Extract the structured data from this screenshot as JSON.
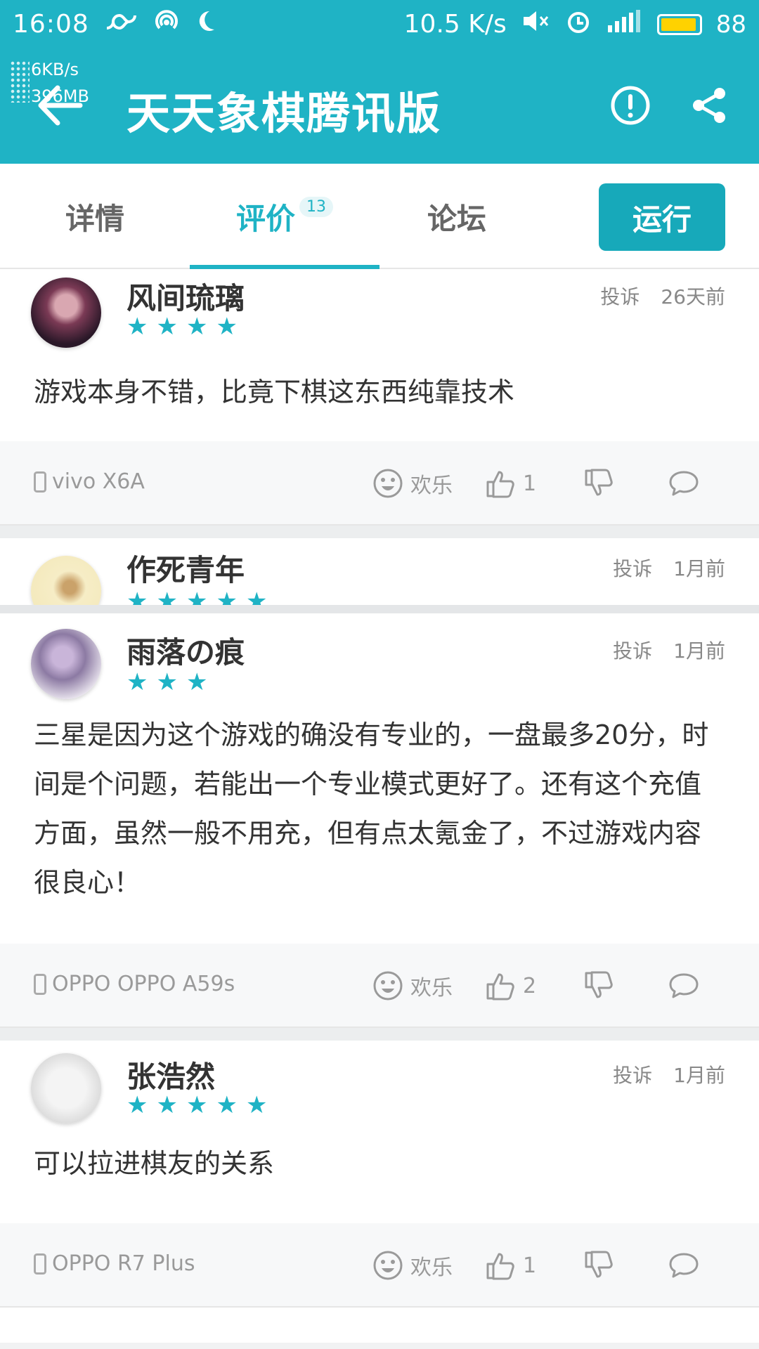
{
  "status_bar": {
    "time": "16:08",
    "network_speed": "10.5 K/s",
    "battery": "88"
  },
  "overlay": {
    "upload": "6KB/s",
    "memory": "396MB"
  },
  "app_bar": {
    "title": "天天象棋腾讯版"
  },
  "tabs": {
    "detail": "详情",
    "reviews": "评价",
    "reviews_badge": "13",
    "forum": "论坛",
    "run": "运行"
  },
  "reviews": [
    {
      "user": "风间琉璃",
      "stars": 4,
      "report": "投诉",
      "time": "26天前",
      "text": "游戏本身不错，比竟下棋这东西纯靠技术",
      "device": "vivo X6A",
      "mood": "欢乐",
      "likes": "1"
    },
    {
      "user": "作死青年",
      "stars": 5,
      "report": "投诉",
      "time": "1月前"
    },
    {
      "user": "雨落の痕",
      "stars": 3,
      "report": "投诉",
      "time": "1月前",
      "text": "三星是因为这个游戏的确没有专业的，一盘最多20分，时间是个问题，若能出一个专业模式更好了。还有这个充值方面，虽然一般不用充，但有点太氪金了，不过游戏内容很良心！",
      "device": "OPPO OPPO A59s",
      "mood": "欢乐",
      "likes": "2"
    },
    {
      "user": "张浩然",
      "stars": 5,
      "report": "投诉",
      "time": "1月前",
      "text": "可以拉进棋友的关系",
      "device": "OPPO R7 Plus",
      "mood": "欢乐",
      "likes": "1"
    }
  ],
  "icons": {
    "back": "arrow-left-icon",
    "report": "exclamation-circle-icon",
    "share": "share-icon",
    "device": "phone-icon",
    "mood": "smile-icon",
    "like": "thumb-up-icon",
    "dislike": "thumb-down-icon",
    "comment": "chat-bubble-icon"
  },
  "colors": {
    "primary": "#1fb3c5",
    "run_button": "#17a9ba"
  }
}
